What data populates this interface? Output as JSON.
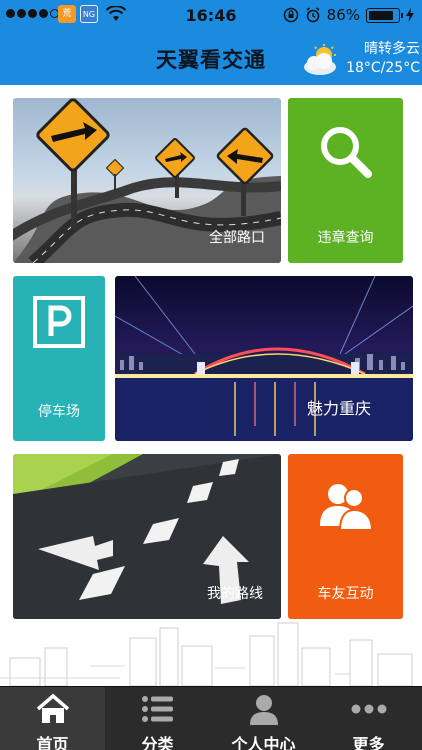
{
  "status_bar": {
    "badge_1": "荒",
    "badge_2": "NG",
    "time": "16:46",
    "battery": "86%",
    "battery_level": 0.86
  },
  "header": {
    "title": "天翼看交通",
    "weather": {
      "condition": "晴转多云",
      "temperature": "18°C/25°C",
      "icon": "partly-cloudy-icon"
    }
  },
  "tiles": {
    "roads": {
      "label": "全部路口",
      "icon": "road-signs-image"
    },
    "violation": {
      "label": "违章查询",
      "icon": "search-icon",
      "color": "#5cb223"
    },
    "parking": {
      "label": "停车场",
      "icon": "parking-icon",
      "color": "#27b3b6"
    },
    "chongqing": {
      "label": "魅力重庆",
      "icon": "bridge-night-image"
    },
    "route": {
      "label": "我的路线",
      "icon": "road-arrows-image"
    },
    "friends": {
      "label": "车友互动",
      "icon": "people-icon",
      "color": "#f25c10"
    }
  },
  "tabbar": {
    "items": [
      {
        "label": "首页",
        "icon": "home-icon",
        "active": true
      },
      {
        "label": "分类",
        "icon": "list-icon",
        "active": false
      },
      {
        "label": "个人中心",
        "icon": "person-icon",
        "active": false
      },
      {
        "label": "更多",
        "icon": "more-icon",
        "active": false
      }
    ]
  },
  "colors": {
    "primary": "#1b8be0",
    "tabbar": "#2b2b2b"
  }
}
